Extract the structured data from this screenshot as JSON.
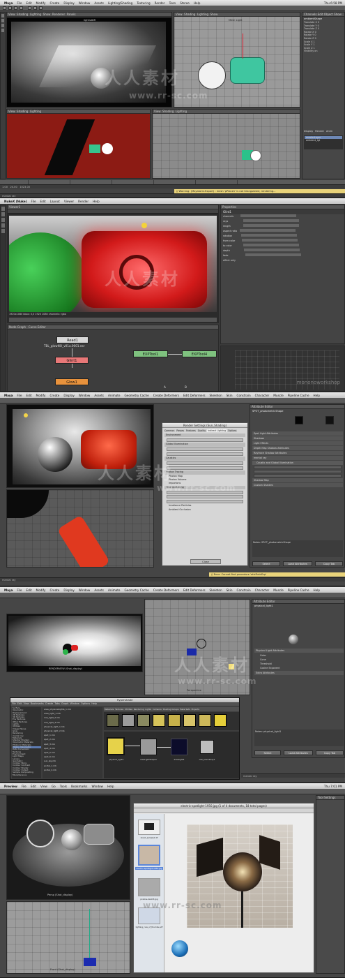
{
  "watermark": {
    "cn": "人人素材",
    "url": "www.rr-sc.com"
  },
  "s1": {
    "menu": [
      "Maya",
      "File",
      "Edit",
      "Modify",
      "Create",
      "Display",
      "Window",
      "Assets",
      "Lighting/Shading",
      "Texturing",
      "Render",
      "Toon",
      "Stereo",
      "Help"
    ],
    "clock": "Thu 6:58 PM",
    "vp_top_left": "lightsABR",
    "vp_top_right": "Mesh Light",
    "vp_menu": [
      "View",
      "Shading",
      "Lighting",
      "Show",
      "Renderer",
      "Panels"
    ],
    "channel_box_header": "Channels  Edit  Object  Show",
    "object_name": "ambientShape",
    "channels": [
      "Translate X 0",
      "Translate Y 0",
      "Translate Z 0",
      "Rotate X 0",
      "Rotate Y 0",
      "Rotate Z 0",
      "Scale X 1",
      "Scale Y 1",
      "Scale Z 1",
      "Visibility on"
    ],
    "layers": [
      "Display",
      "Render",
      "Anim"
    ],
    "layer_rows": [
      "masterLayer",
      "ambient_lgt"
    ],
    "warning": "// Warning: (Mayatomr.Export) : mesh 'pPlane1' is not triangulated, rendering...",
    "status": "mental ray",
    "time_start": "1.00",
    "time_end": "24.00",
    "range_end": "1023.00"
  },
  "s2": {
    "menu": [
      "NukeX (Nuke)",
      "File",
      "Edit",
      "Layout",
      "Viewer",
      "Render",
      "Help"
    ],
    "viewer_tab": "Viewer1",
    "viewer_info": "1920x1080  bbox: 0,0 1920 1080  channels: rgba",
    "nodegraph_tab": "Node Graph",
    "curve_tab": "Curve Editor",
    "nodes": {
      "read": "Read1",
      "read_file": "TBL_glowNO_v01a.0001.exr",
      "glint": "Glint1",
      "glow": "Glow1",
      "exp1": "EXPTool1",
      "exp2": "EXPTool4"
    },
    "props_tab": "Properties",
    "props_node": "Glint1",
    "props_rows": [
      "channels",
      "rays",
      "length",
      "aspect ratio",
      "rotation",
      "from color",
      "to color",
      "depth",
      "fade",
      "effect only"
    ],
    "input_a": "A",
    "input_b": "B",
    "brand": "mononoworkshop"
  },
  "s3": {
    "menu": [
      "Maya",
      "File",
      "Edit",
      "Modify",
      "Create",
      "Display",
      "Window",
      "Assets",
      "Animate",
      "Geometry Cache",
      "Create Deformers",
      "Edit Deformers",
      "Skeleton",
      "Skin",
      "Constrain",
      "Character",
      "Muscle",
      "Pipeline Cache",
      "Help"
    ],
    "render_settings_title": "Render Settings (Sun_Shading)",
    "rs_tabs": [
      "Common",
      "Passes",
      "Features",
      "Quality",
      "Indirect Lighting",
      "Options"
    ],
    "rs_sections": [
      "Environment",
      "Global Illumination",
      "Caustics",
      "Photon Tracing",
      "Photon Map",
      "Photon Volume",
      "Importons",
      "Final Gathering",
      "Irradiance Particles",
      "Ambient Occlusion"
    ],
    "rs_buttons": [
      "Close"
    ],
    "attr_editor_title": "Attribute Editor",
    "attr_node": "SPOT_photometricShape",
    "attr_sections": [
      "Spot Light Attributes",
      "Shadows",
      "Light Effects",
      "Depth Map Shadow Attributes",
      "Raytrace Shadow Attributes",
      "mental ray",
      "Caustic and Global Illumination",
      "Shadow Map",
      "Custom Shaders"
    ],
    "attr_buttons": [
      "Select",
      "Load Attributes",
      "Copy Tab"
    ],
    "notes": "Notes:  SPOT_photometricShape",
    "warning": "// Error: Cannot find procedure 'attrFieldGrp'",
    "status": "mental ray"
  },
  "s4": {
    "menu": [
      "Maya",
      "File",
      "Edit",
      "Modify",
      "Create",
      "Display",
      "Window",
      "Assets",
      "Animate",
      "Geometry Cache",
      "Create Deformers",
      "Edit Deformers",
      "Skeleton",
      "Skin",
      "Constrain",
      "Character",
      "Muscle",
      "Pipeline Cache",
      "Help"
    ],
    "render_view_label": "RENDERVIEW (Shot_display)",
    "hypershade_title": "Hypershade",
    "hs_menu": [
      "File",
      "Edit",
      "View",
      "Bookmarks",
      "Create",
      "Tabs",
      "Graph",
      "Window",
      "Options",
      "Help"
    ],
    "hs_tabs": [
      "Materials",
      "Textures",
      "Utilities",
      "Rendering",
      "Lights",
      "Cameras",
      "Shading Groups",
      "Bake Sets",
      "Projects"
    ],
    "hs_list": [
      "Surface",
      "Volumetric",
      "Displacement",
      "2D Textures",
      "3D Textures",
      "Env Textures",
      "Other Textures",
      "Lights",
      "Utilities",
      "Image Planes",
      "Glow",
      "Rendering",
      "mental ray",
      "Materials",
      "Shadow Shaders",
      "Volumetric Materials",
      "Photonic Materials",
      "Photon Volumetric",
      "Data Conversion",
      "Textures",
      "Environment",
      "Light Maps",
      "Lenses",
      "Geometry",
      "Contour Store",
      "Contour Contrast",
      "Contour Shader",
      "Contour Output",
      "Sample Compositing",
      "Miscellaneous"
    ],
    "hs_files": [
      "area_physicalLights_1.mb",
      "area_light_1.mb",
      "mia_light_2.mb",
      "mia_light_3.mb",
      "physical_light_1.mb",
      "physical_light_2.mb",
      "spot_1.mb",
      "spot_2.mb",
      "spot_3.mb",
      "spot_4.mb",
      "spot_5.mb",
      "spot_6.mb",
      "sun_sky.mb",
      "portal_1.mb",
      "portal_2.mb"
    ],
    "hs_nodes": [
      "physical_light1",
      "areaLightShape1",
      "areaLight1",
      "mib_blackbody1"
    ],
    "attr_editor_title": "Attribute Editor",
    "attr_node": "physical_light1",
    "attr_sections": [
      "Physical Light Attributes",
      "Color",
      "Cone",
      "Threshold",
      "Cosine Exponent",
      "Extra Attributes"
    ],
    "attr_buttons": [
      "Select",
      "Load Attributes",
      "Copy Tab"
    ],
    "notes": "Notes:  physical_light1",
    "panel_label": "Perspective",
    "status": "mental ray"
  },
  "s5": {
    "menu": [
      "Preview",
      "File",
      "Edit",
      "View",
      "Go",
      "Tools",
      "Bookmarks",
      "Window",
      "Help"
    ],
    "clock": "Thu 7:01 PM",
    "doc_title": "electric-spotlight-1950.jpg (1 of 4 documents, 18 total pages)",
    "thumb_labels": [
      "shoot_sample1.tif",
      "electric-spotlight-1950.jpg",
      "praline-backlit.jpg",
      "lighting_rule_of_thumbs.pdf"
    ],
    "persp_label": "Persp (Shot_display)",
    "front_label": "Front (Shot_display)",
    "tool_settings": "Tool Settings"
  }
}
